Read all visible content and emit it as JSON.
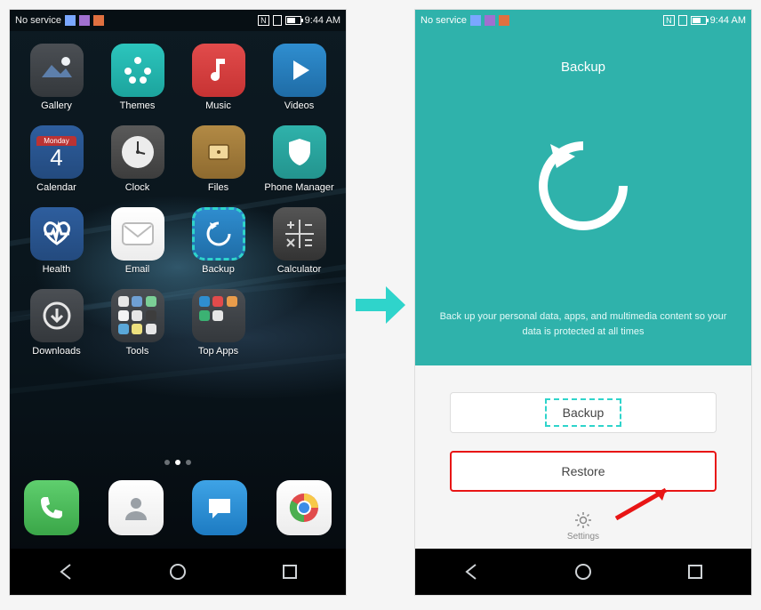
{
  "status": {
    "service": "No service",
    "time": "9:44 AM"
  },
  "home": {
    "apps": [
      {
        "id": "gallery",
        "label": "Gallery"
      },
      {
        "id": "themes",
        "label": "Themes"
      },
      {
        "id": "music",
        "label": "Music"
      },
      {
        "id": "videos",
        "label": "Videos"
      },
      {
        "id": "calendar",
        "label": "Calendar",
        "day_label": "Monday",
        "day": "4"
      },
      {
        "id": "clock",
        "label": "Clock"
      },
      {
        "id": "files",
        "label": "Files"
      },
      {
        "id": "phonemgr",
        "label": "Phone Manager"
      },
      {
        "id": "health",
        "label": "Health"
      },
      {
        "id": "email",
        "label": "Email"
      },
      {
        "id": "backup",
        "label": "Backup"
      },
      {
        "id": "calculator",
        "label": "Calculator"
      },
      {
        "id": "downloads",
        "label": "Downloads"
      },
      {
        "id": "tools",
        "label": "Tools"
      },
      {
        "id": "topapps",
        "label": "Top Apps"
      }
    ],
    "dock": [
      {
        "id": "phone",
        "label": "Phone"
      },
      {
        "id": "contacts",
        "label": "Contacts"
      },
      {
        "id": "messages",
        "label": "Messages"
      },
      {
        "id": "chrome",
        "label": "Chrome"
      }
    ]
  },
  "backup_screen": {
    "title": "Backup",
    "message": "Back up your personal data, apps, and multimedia content so your data is protected at all times",
    "backup_btn": "Backup",
    "restore_btn": "Restore",
    "settings": "Settings"
  }
}
